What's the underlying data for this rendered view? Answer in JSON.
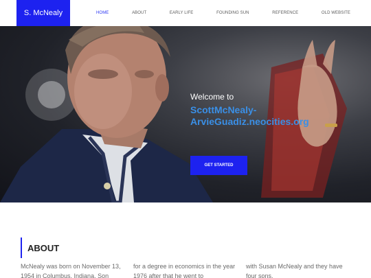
{
  "header": {
    "brand": "S. McNealy",
    "nav": [
      {
        "label": "HOME",
        "active": true
      },
      {
        "label": "ABOUT",
        "active": false
      },
      {
        "label": "EARLY LIFE",
        "active": false
      },
      {
        "label": "FOUNDING SUN",
        "active": false
      },
      {
        "label": "REFERENCE",
        "active": false
      },
      {
        "label": "OLD WEBSITE",
        "active": false
      }
    ]
  },
  "hero": {
    "welcome": "Welcome to",
    "site_name": "ScottMcNealy-ArvieGuadiz.neocities.org",
    "cta_label": "GET STARTED"
  },
  "about": {
    "title": "ABOUT",
    "columns": [
      "McNealy was born on November 13, 1954 in Columbus, Indiana. Son",
      "for a degree in economics in the year 1976 after that he went to",
      "with Susan McNealy and they have four sons."
    ]
  },
  "colors": {
    "accent": "#1d22f0",
    "site_name_blue": "#3a8fe6"
  }
}
